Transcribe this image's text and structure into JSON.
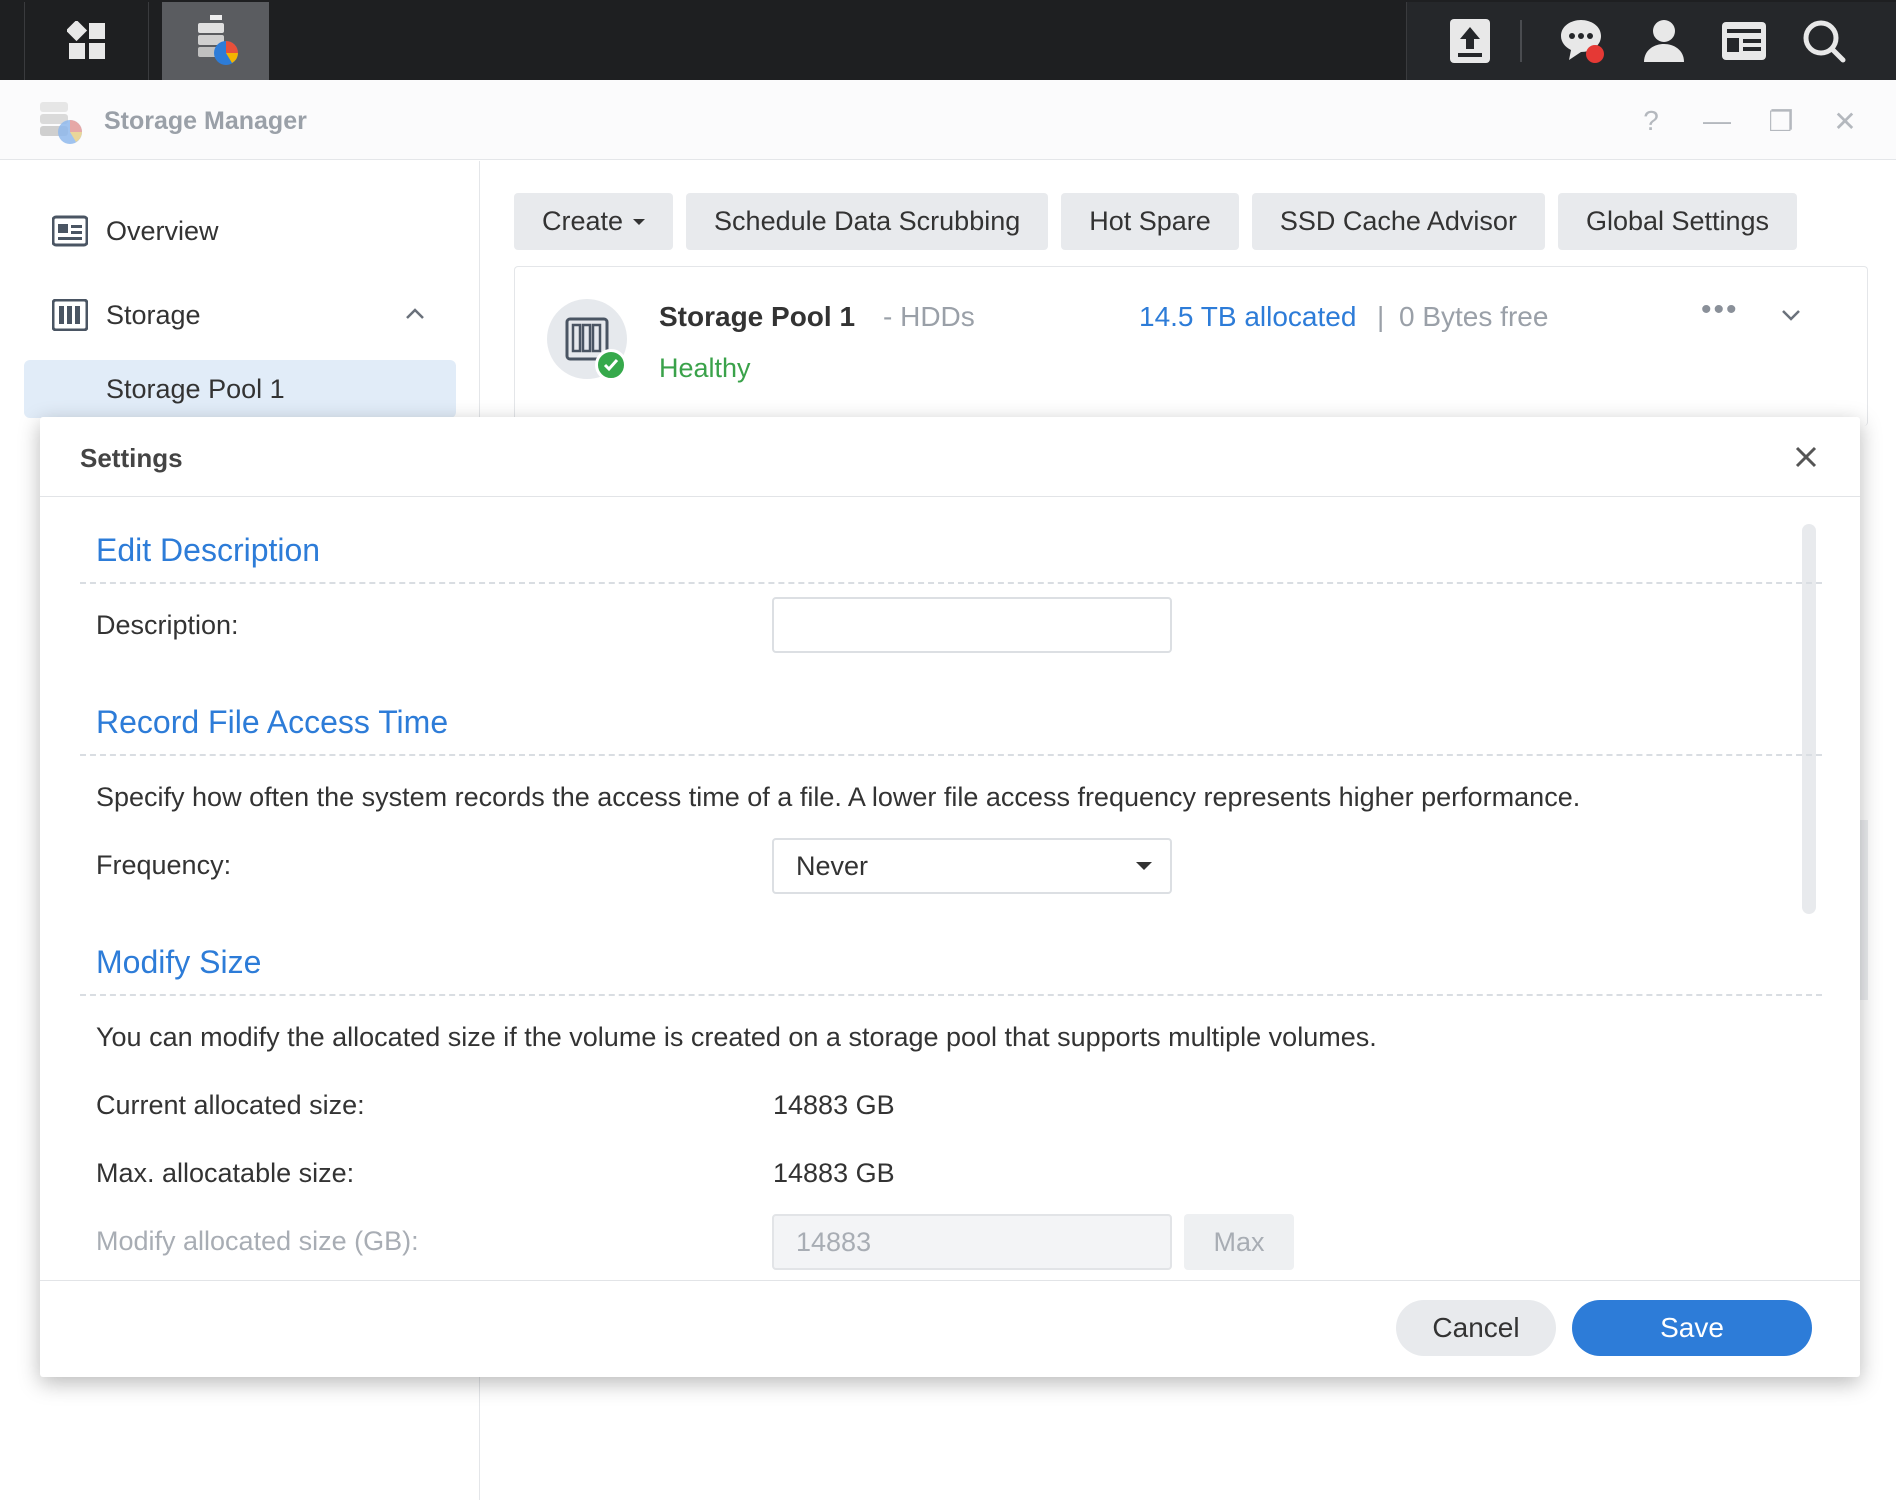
{
  "taskbar": {
    "left_icons": [
      "main-menu-icon",
      "storage-manager-app-icon"
    ],
    "right_icons": [
      "upload-icon",
      "chat-notification-icon",
      "user-icon",
      "widgets-icon",
      "search-icon"
    ]
  },
  "window": {
    "title": "Storage Manager",
    "controls": {
      "help": "?",
      "minimize": "—",
      "restore": "❐",
      "close": "✕"
    }
  },
  "sidebar": {
    "items": [
      {
        "label": "Overview",
        "icon": "overview-icon"
      },
      {
        "label": "Storage",
        "icon": "storage-icon",
        "expanded": true
      }
    ],
    "subitems": [
      {
        "label": "Storage Pool 1",
        "selected": true
      }
    ]
  },
  "toolbar": {
    "create": "Create",
    "schedule_scrubbing": "Schedule Data Scrubbing",
    "hot_spare": "Hot Spare",
    "ssd_cache_advisor": "SSD Cache Advisor",
    "global_settings": "Global Settings"
  },
  "pool": {
    "name": "Storage Pool 1",
    "type": "- HDDs",
    "status": "Healthy",
    "allocated": "14.5 TB allocated",
    "separator": "|",
    "free": "0 Bytes free",
    "more": "•••"
  },
  "dialog": {
    "title": "Settings",
    "sections": {
      "edit_description": {
        "title": "Edit Description",
        "description_label": "Description:",
        "description_value": ""
      },
      "access_time": {
        "title": "Record File Access Time",
        "help_text": "Specify how often the system records the access time of a file. A lower file access frequency represents higher performance.",
        "frequency_label": "Frequency:",
        "frequency_value": "Never"
      },
      "modify_size": {
        "title": "Modify Size",
        "help_text": "You can modify the allocated size if the volume is created on a storage pool that supports multiple volumes.",
        "current_label": "Current allocated size:",
        "current_value": "14883 GB",
        "max_label": "Max. allocatable size:",
        "max_value": "14883 GB",
        "modify_label": "Modify allocated size (GB):",
        "modify_value": "14883",
        "max_button": "Max"
      }
    },
    "cancel": "Cancel",
    "save": "Save"
  },
  "colors": {
    "accent": "#2d7cd8",
    "healthy": "#3aa24a",
    "taskbar": "#1e1f21"
  }
}
